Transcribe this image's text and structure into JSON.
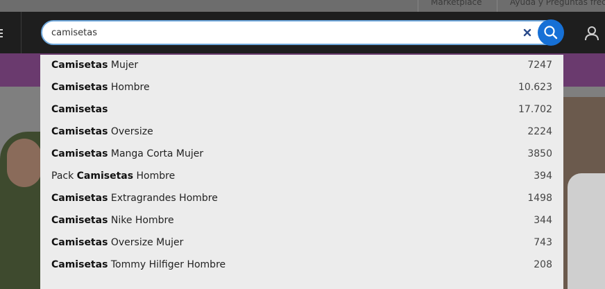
{
  "topnav": {
    "links": [
      "Marketplace",
      "Ayuda y Preguntas frec"
    ]
  },
  "search": {
    "value": "camisetas",
    "placeholder": ""
  },
  "suggestions": [
    {
      "prefix": "",
      "bold": "Camisetas",
      "suffix": " Mujer",
      "count": "7247"
    },
    {
      "prefix": "",
      "bold": "Camisetas",
      "suffix": " Hombre",
      "count": "10.623"
    },
    {
      "prefix": "",
      "bold": "Camisetas",
      "suffix": "",
      "count": "17.702"
    },
    {
      "prefix": "",
      "bold": "Camisetas",
      "suffix": " Oversize",
      "count": "2224"
    },
    {
      "prefix": "",
      "bold": "Camisetas",
      "suffix": " Manga Corta Mujer",
      "count": "3850"
    },
    {
      "prefix": "Pack ",
      "bold": "Camisetas",
      "suffix": " Hombre",
      "count": "394"
    },
    {
      "prefix": "",
      "bold": "Camisetas",
      "suffix": " Extragrandes Hombre",
      "count": "1498"
    },
    {
      "prefix": "",
      "bold": "Camisetas",
      "suffix": " Nike Hombre",
      "count": "344"
    },
    {
      "prefix": "",
      "bold": "Camisetas",
      "suffix": " Oversize Mujer",
      "count": "743"
    },
    {
      "prefix": "",
      "bold": "Camisetas",
      "suffix": " Tommy Hilfiger Hombre",
      "count": "208"
    }
  ],
  "icons": {
    "menu": "menu-icon",
    "clear": "close-icon",
    "search": "search-icon",
    "user": "user-icon"
  },
  "colors": {
    "accent": "#1670d6",
    "promo": "#6a3a6e",
    "header": "#1e1e1e",
    "dropdown": "#ececec"
  }
}
